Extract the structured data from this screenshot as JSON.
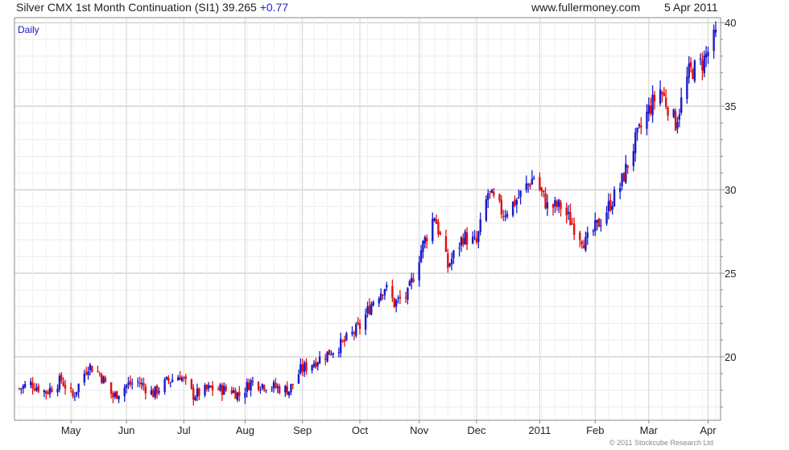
{
  "header": {
    "title": "Silver CMX 1st Month Continuation (SI1) 39.265",
    "change": "+0.77",
    "site": "www.fullermoney.com",
    "date": "5 Apr 2011"
  },
  "copyright": "© 2011 Stockcube Research Ltd",
  "colors": {
    "up": "#1a1acc",
    "down": "#e01010",
    "grid": "#d8d8d8",
    "border": "#888888",
    "label": "#1a1acc"
  },
  "chart_data": {
    "type": "candlestick",
    "period_label": "Daily",
    "date_start": "2010-04-06",
    "date_end": "2011-04-05",
    "ylim": [
      16.2,
      40.3
    ],
    "y_ticks": [
      20,
      25,
      30,
      35,
      40
    ],
    "x_ticks": [
      {
        "label": "May",
        "date": "2010-05-03"
      },
      {
        "label": "Jun",
        "date": "2010-06-01"
      },
      {
        "label": "Jul",
        "date": "2010-07-01"
      },
      {
        "label": "Aug",
        "date": "2010-08-02"
      },
      {
        "label": "Sep",
        "date": "2010-09-01"
      },
      {
        "label": "Oct",
        "date": "2010-10-01"
      },
      {
        "label": "Nov",
        "date": "2010-11-01"
      },
      {
        "label": "Dec",
        "date": "2010-12-01"
      },
      {
        "label": "2011",
        "date": "2011-01-03"
      },
      {
        "label": "Feb",
        "date": "2011-02-01"
      },
      {
        "label": "Mar",
        "date": "2011-03-01"
      },
      {
        "label": "Apr",
        "date": "2011-04-01"
      }
    ],
    "grid": true,
    "anchors": [
      [
        "2010-04-06",
        18.1
      ],
      [
        "2010-04-12",
        18.4
      ],
      [
        "2010-04-20",
        17.9
      ],
      [
        "2010-04-28",
        18.6
      ],
      [
        "2010-05-04",
        17.6
      ],
      [
        "2010-05-12",
        19.5
      ],
      [
        "2010-05-18",
        19.0
      ],
      [
        "2010-05-25",
        17.6
      ],
      [
        "2010-06-01",
        18.3
      ],
      [
        "2010-06-07",
        18.5
      ],
      [
        "2010-06-15",
        17.8
      ],
      [
        "2010-06-22",
        18.5
      ],
      [
        "2010-06-29",
        18.9
      ],
      [
        "2010-07-06",
        17.7
      ],
      [
        "2010-07-15",
        18.1
      ],
      [
        "2010-07-26",
        18.0
      ],
      [
        "2010-07-30",
        17.7
      ],
      [
        "2010-08-05",
        18.5
      ],
      [
        "2010-08-17",
        18.2
      ],
      [
        "2010-08-25",
        18.0
      ],
      [
        "2010-08-31",
        19.2
      ],
      [
        "2010-09-10",
        19.9
      ],
      [
        "2010-09-22",
        20.8
      ],
      [
        "2010-10-01",
        21.8
      ],
      [
        "2010-10-08",
        23.4
      ],
      [
        "2010-10-14",
        24.2
      ],
      [
        "2010-10-19",
        23.2
      ],
      [
        "2010-10-26",
        23.7
      ],
      [
        "2010-11-02",
        26.4
      ],
      [
        "2010-11-09",
        28.5
      ],
      [
        "2010-11-16",
        25.4
      ],
      [
        "2010-11-24",
        27.2
      ],
      [
        "2010-12-01",
        26.8
      ],
      [
        "2010-12-07",
        29.8
      ],
      [
        "2010-12-15",
        28.6
      ],
      [
        "2010-12-22",
        29.4
      ],
      [
        "2010-12-31",
        30.8
      ],
      [
        "2011-01-07",
        29.0
      ],
      [
        "2011-01-14",
        29.0
      ],
      [
        "2011-01-21",
        27.8
      ],
      [
        "2011-01-27",
        26.8
      ],
      [
        "2011-02-04",
        28.2
      ],
      [
        "2011-02-14",
        30.2
      ],
      [
        "2011-02-22",
        32.9
      ],
      [
        "2011-03-01",
        34.8
      ],
      [
        "2011-03-07",
        36.0
      ],
      [
        "2011-03-15",
        34.0
      ],
      [
        "2011-03-22",
        37.0
      ],
      [
        "2011-03-29",
        37.6
      ],
      [
        "2011-04-05",
        39.2
      ]
    ]
  }
}
